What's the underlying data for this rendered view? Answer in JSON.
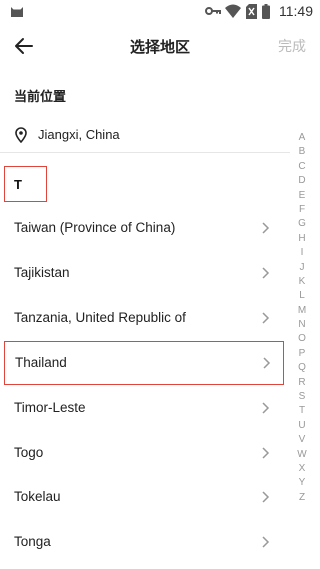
{
  "status_bar": {
    "time": "11:49",
    "icons": [
      "cat-icon",
      "key-icon",
      "wifi-icon",
      "no-sim-icon",
      "battery-icon"
    ]
  },
  "header": {
    "title": "选择地区",
    "done_label": "完成",
    "back_icon": "back-arrow-icon"
  },
  "current_location": {
    "section_label": "当前位置",
    "value": "Jiangxi, China",
    "icon": "location-pin-icon"
  },
  "list": {
    "letter": "T",
    "items": [
      "Taiwan (Province of China)",
      "Tajikistan",
      "Tanzania, United Republic of",
      "Thailand",
      "Timor-Leste",
      "Togo",
      "Tokelau",
      "Tonga"
    ],
    "highlighted_item": "Thailand"
  },
  "index_letters": [
    "A",
    "B",
    "C",
    "D",
    "E",
    "F",
    "G",
    "H",
    "I",
    "J",
    "K",
    "L",
    "M",
    "N",
    "O",
    "P",
    "Q",
    "R",
    "S",
    "T",
    "U",
    "V",
    "W",
    "X",
    "Y",
    "Z"
  ],
  "colors": {
    "highlight_border": "#e0443a",
    "done_disabled": "#bbbbbb",
    "index_text": "#999999"
  }
}
